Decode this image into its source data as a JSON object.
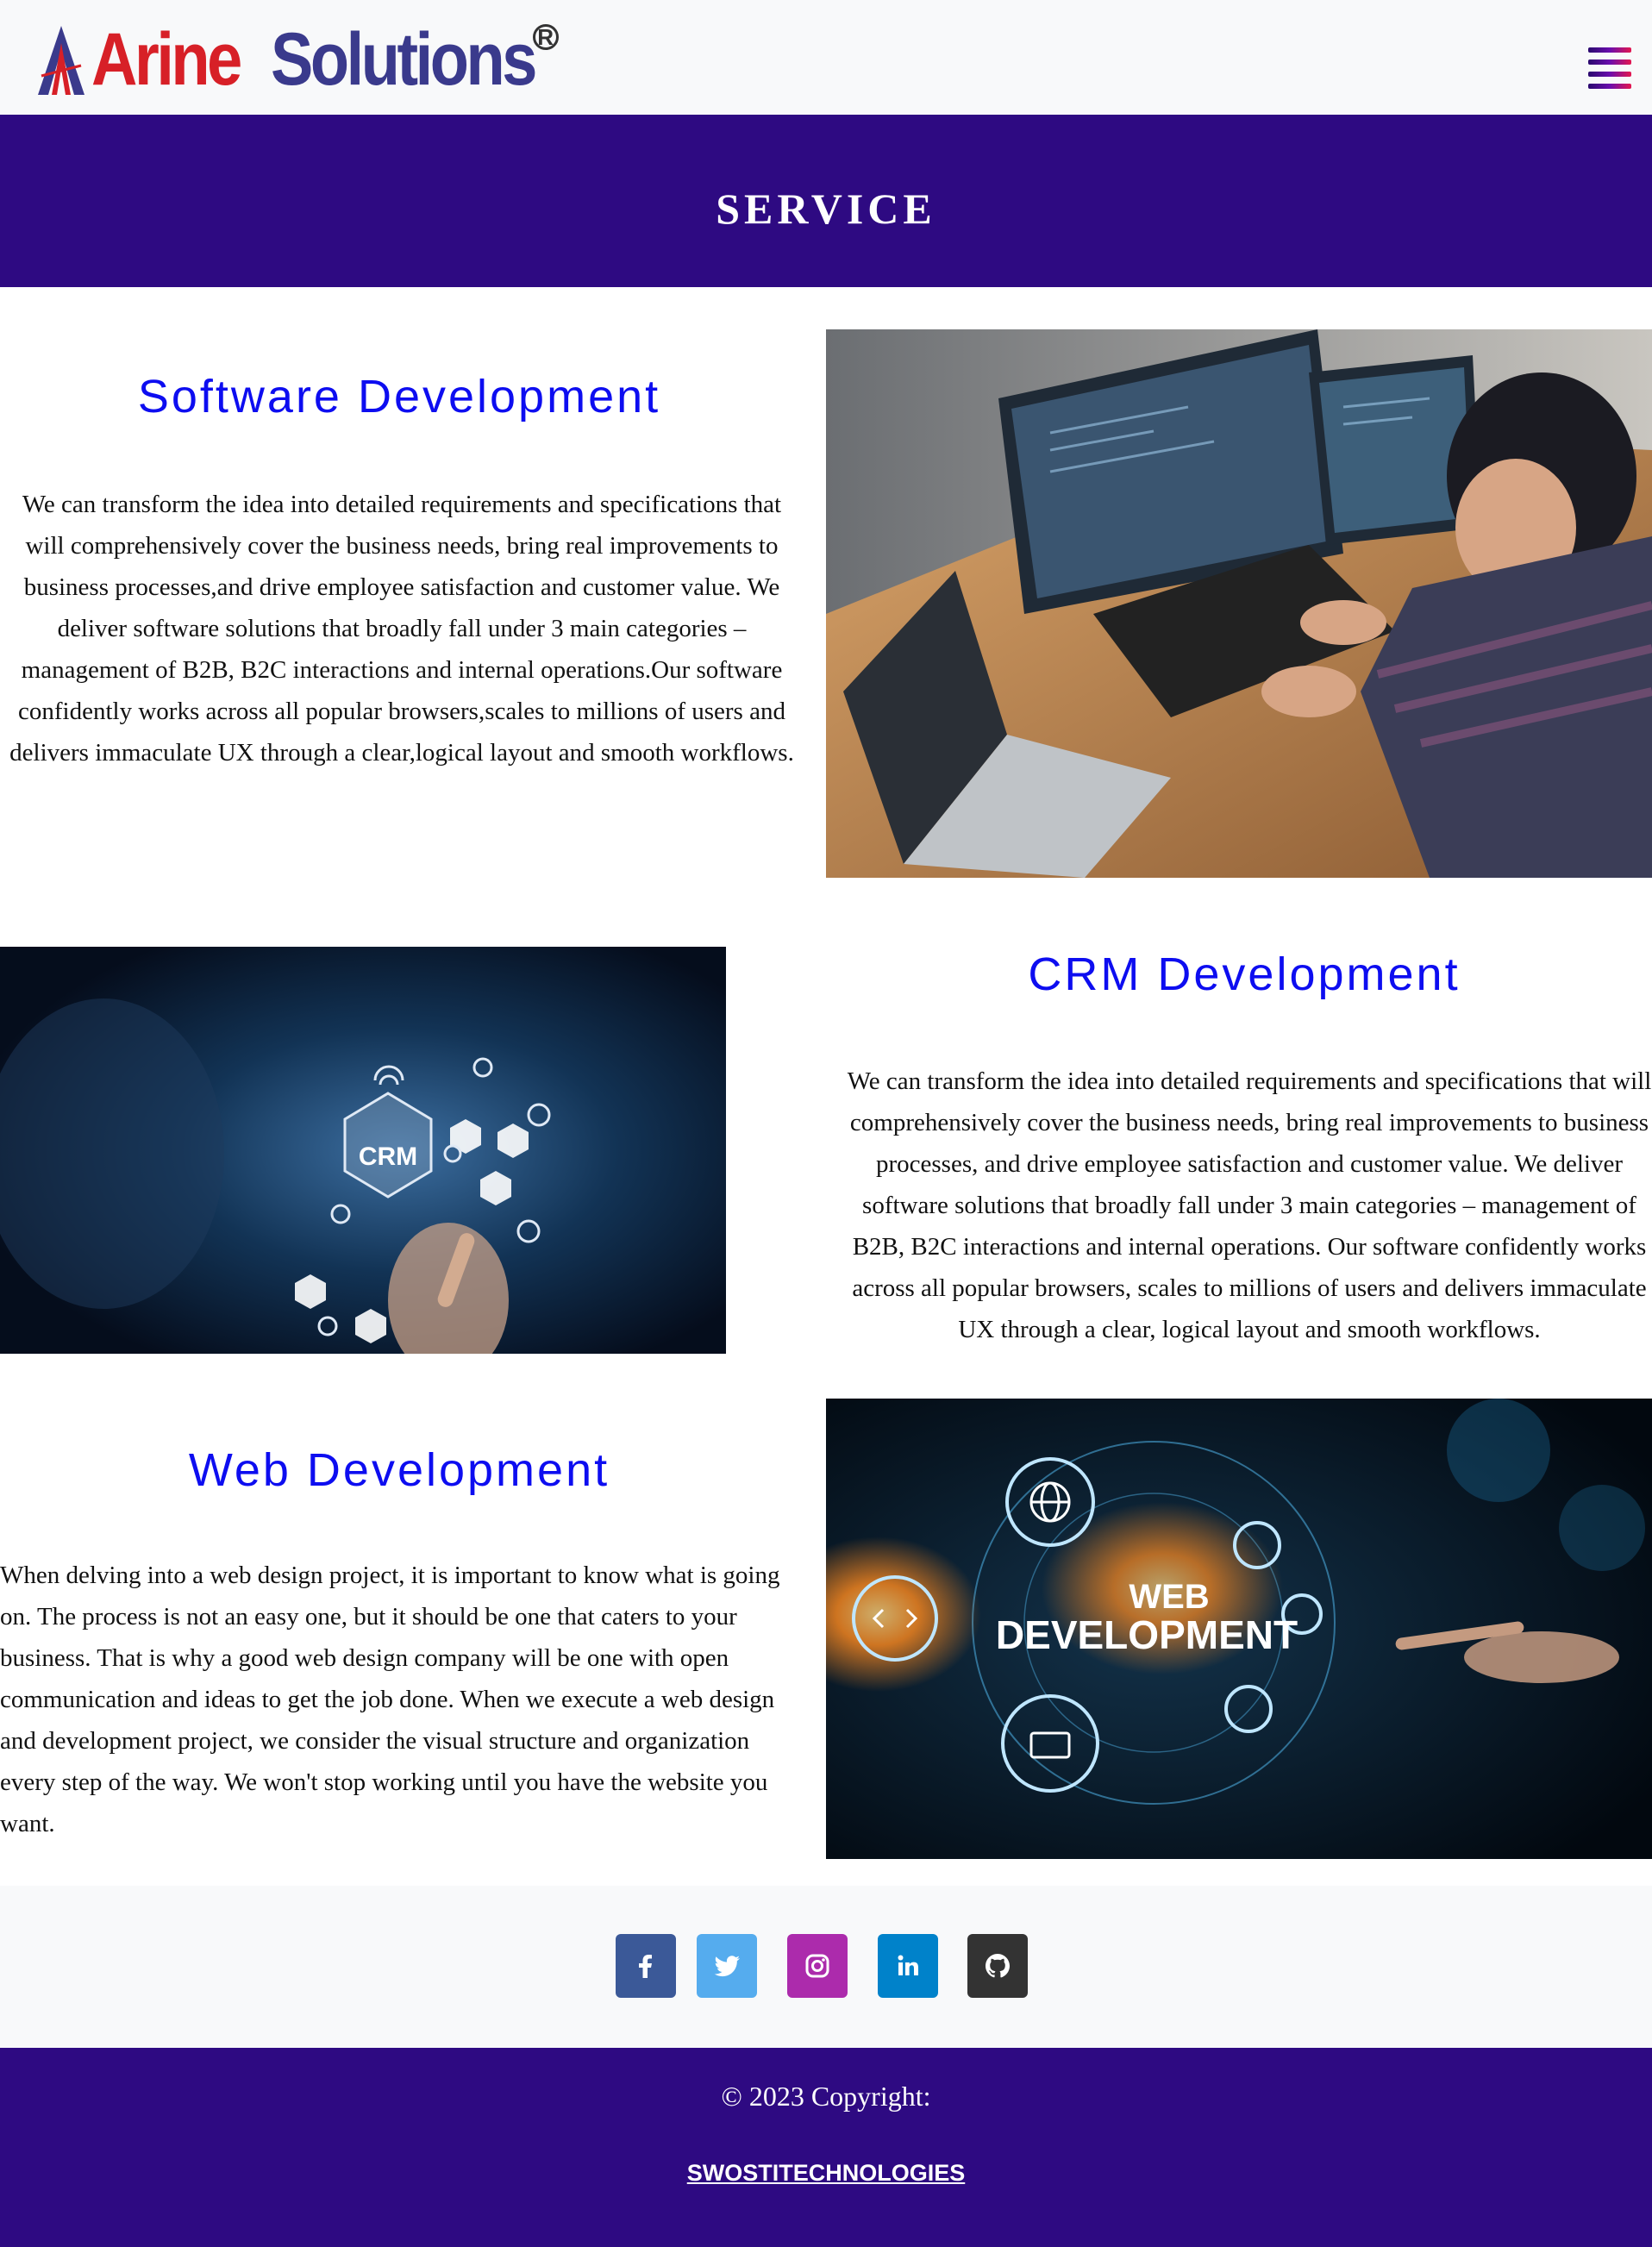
{
  "header": {
    "brand": {
      "word1": "Arine",
      "word2": "Solutions",
      "registered": "R"
    },
    "menu_icon": "hamburger-menu-icon"
  },
  "banner": {
    "title": "SERVICE"
  },
  "services": [
    {
      "title": "Software Development",
      "text": "We can transform the idea into detailed requirements and specifications that will comprehensively cover the business needs, bring real improvements to business processes,and drive employee satisfaction and customer value. We deliver software solutions that broadly fall under 3 main categories – management of B2B, B2C interactions and internal operations.Our software confidently works across all popular browsers,scales to millions of users and delivers immaculate UX through a clear,logical layout and smooth workflows.",
      "image": "developer-coding-photo"
    },
    {
      "title": "CRM Development",
      "text": "We can transform the idea into detailed requirements and specifications that will comprehensively cover the business needs, bring real improvements to business processes, and drive employee satisfaction and customer value. We deliver software solutions that broadly fall under 3 main categories – management of B2B, B2C interactions and internal operations. Our software confidently works across all popular browsers, scales to millions of users and delivers immaculate UX through a clear, logical layout and smooth workflows.",
      "image": "crm-concept-photo",
      "image_label": "CRM"
    },
    {
      "title": "Web Development",
      "text": "When delving into a web design project, it is important to know what is going on. The process is not an easy one, but it should be one that caters to your business. That is why a good web design company will be one with open communication and ideas to get the job done. When we execute a web design and development project, we consider the visual structure and organization every step of the way. We won't stop working until you have the website you want.",
      "image": "web-development-concept-photo",
      "image_label_line1": "WEB",
      "image_label_line2": "DEVELOPMENT"
    }
  ],
  "social": [
    {
      "name": "facebook-icon",
      "color": "#3b5998"
    },
    {
      "name": "twitter-icon",
      "color": "#55acee"
    },
    {
      "name": "instagram-icon",
      "color": "#ac2bac"
    },
    {
      "name": "linkedin-icon",
      "color": "#0082ca"
    },
    {
      "name": "github-icon",
      "color": "#333333"
    }
  ],
  "footer": {
    "copyright": "© 2023 Copyright:",
    "link": "SWOSTITECHNOLOGIES"
  },
  "colors": {
    "primary": "#2e0a82",
    "heading_blue": "#0d0df0",
    "light_bg": "#f8f9fa"
  }
}
